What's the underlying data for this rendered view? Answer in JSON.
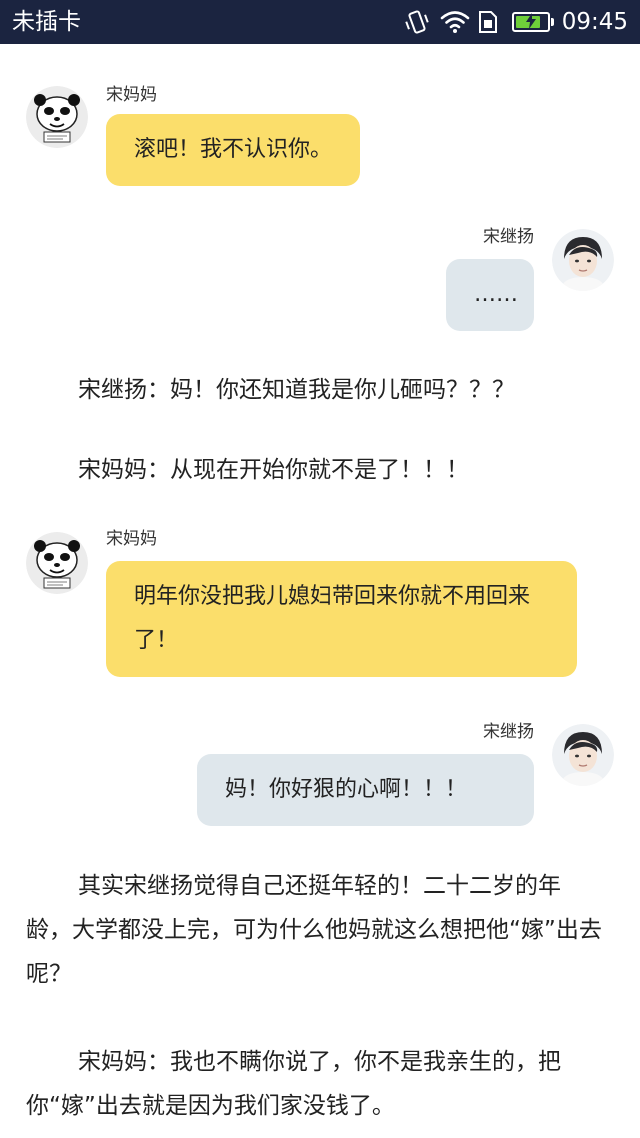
{
  "status_bar": {
    "carrier": "未插卡",
    "time": "09:45",
    "battery_level": 0.8,
    "icons": [
      "vibrate-icon",
      "wifi-icon",
      "sim-card-icon",
      "battery-icon"
    ]
  },
  "chat": {
    "messages": [
      {
        "sender": "宋妈妈",
        "side": "left",
        "avatar": "panda-meme-avatar",
        "text": "滚吧！我不认识你。"
      },
      {
        "sender": "宋继扬",
        "side": "right",
        "avatar": "boy-avatar",
        "text": "……"
      },
      {
        "sender": "宋妈妈",
        "side": "left",
        "avatar": "panda-meme-avatar",
        "text": "明年你没把我儿媳妇带回来你就不用回来了！"
      },
      {
        "sender": "宋继扬",
        "side": "right",
        "avatar": "boy-avatar",
        "text": "妈！你好狠的心啊！！！"
      }
    ],
    "narration": [
      "宋继扬：妈！你还知道我是你儿砸吗？？？",
      "宋妈妈：从现在开始你就不是了！！！",
      "其实宋继扬觉得自己还挺年轻的！二十二岁的年龄，大学都没上完，可为什么他妈就这么想把他“嫁”出去呢？",
      "宋妈妈：我也不瞒你说了，你不是我亲生的，把你“嫁”出去就是因为我们家没钱了。"
    ]
  },
  "colors": {
    "status_bar_bg": "#1b2440",
    "left_bubble": "#fbde6b",
    "right_bubble": "#dfe7ec",
    "battery_fill": "#6fcf3a"
  }
}
